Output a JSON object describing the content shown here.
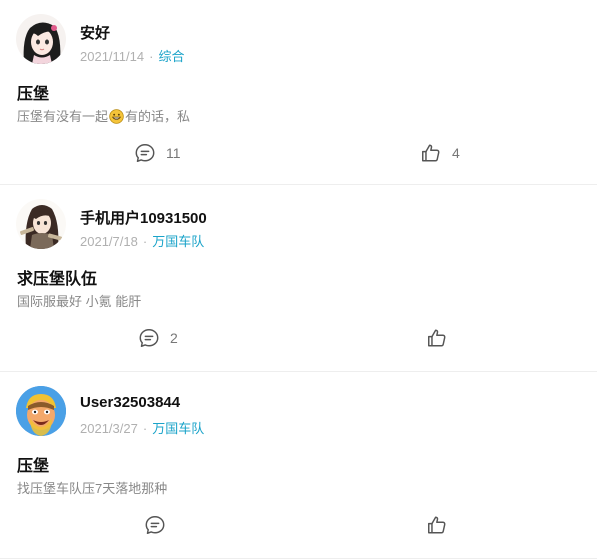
{
  "posts": [
    {
      "username": "安好",
      "date": "2021/11/14",
      "tag": "综合",
      "title": "压堡",
      "excerpt_before": "压堡有没有一起",
      "excerpt_emoji": "grinning-emoji",
      "excerpt_after": "有的话，私",
      "comments": "11",
      "likes": "4",
      "avatar": "anime-girl-avatar"
    },
    {
      "username": "手机用户10931500",
      "date": "2021/7/18",
      "tag": "万国车队",
      "title": "求压堡队伍",
      "excerpt_before": "国际服最好 小氪 能肝",
      "comments": "2",
      "likes": "",
      "avatar": "anime-character-avatar"
    },
    {
      "username": "User32503844",
      "date": "2021/3/27",
      "tag": "万国车队",
      "title": "压堡",
      "excerpt_before": "找压堡车队压7天落地那种",
      "comments": "",
      "likes": "",
      "avatar": "barbarian-avatar"
    }
  ],
  "meta_separator": "·",
  "colors": {
    "tag": "#1aa3c9",
    "meta": "#b0b0b0",
    "divider": "#eeeeee"
  }
}
